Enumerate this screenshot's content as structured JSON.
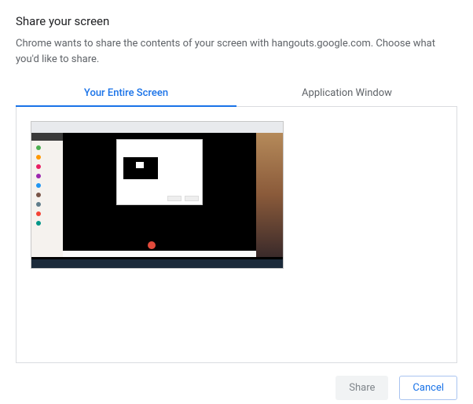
{
  "dialog": {
    "title": "Share your screen",
    "subtitle": "Chrome wants to share the contents of your screen with hangouts.google.com. Choose what you'd like to share."
  },
  "tabs": {
    "entire_screen": "Your Entire Screen",
    "app_window": "Application Window"
  },
  "buttons": {
    "share": "Share",
    "cancel": "Cancel"
  }
}
